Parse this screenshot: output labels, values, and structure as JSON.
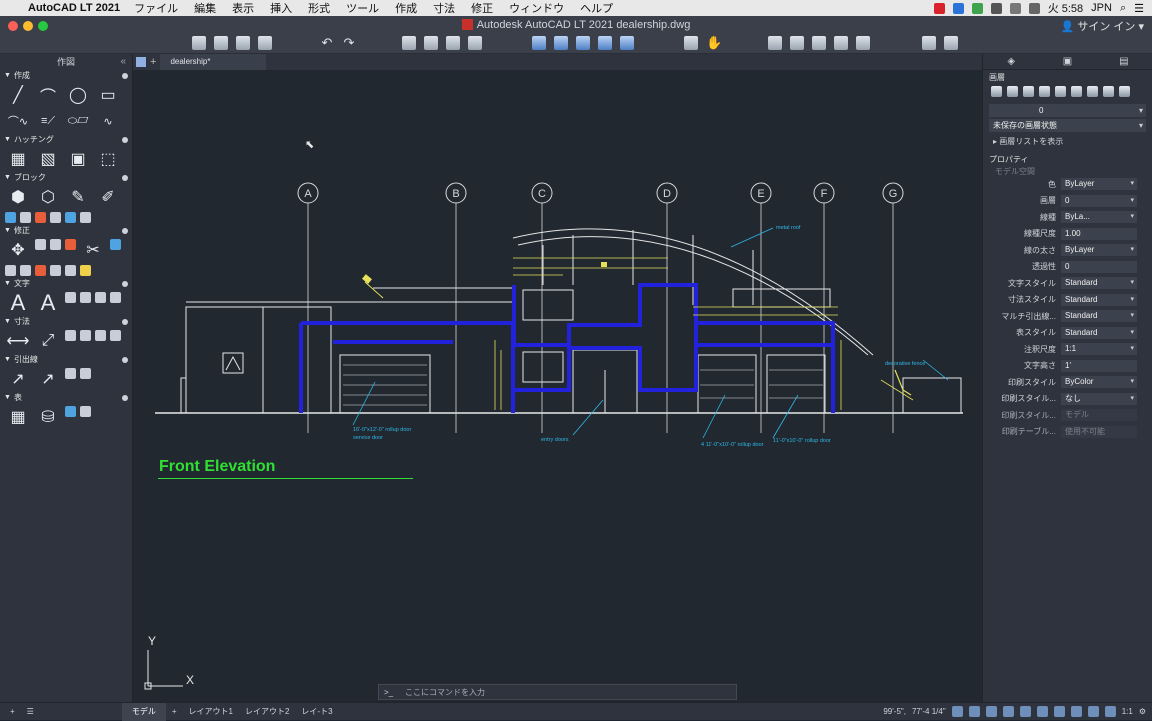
{
  "menubar": {
    "app_name": "AutoCAD LT 2021",
    "items": [
      "ファイル",
      "編集",
      "表示",
      "挿入",
      "形式",
      "ツール",
      "作成",
      "寸法",
      "修正",
      "ウィンドウ",
      "ヘルプ"
    ],
    "clock": "火 5:58",
    "input_method": "JPN"
  },
  "window": {
    "title": "Autodesk AutoCAD LT 2021   dealership.dwg",
    "signin": "サイン イン"
  },
  "left_panel": {
    "title": "作図",
    "sections": [
      "作成",
      "ハッチング",
      "ブロック",
      "修正",
      "文字",
      "寸法",
      "引出線",
      "表"
    ]
  },
  "doc_tab": "dealership*",
  "drawing": {
    "grid_labels": [
      "A",
      "B",
      "C",
      "D",
      "E",
      "F",
      "G"
    ],
    "title": "Front Elevation",
    "annotations": {
      "metal_roof": "metal roof",
      "decorative_fence": "decorative fence",
      "rollup_1": "16'-0\"x12'-0\" rollup door",
      "rollup_1b": "service door",
      "entry": "entry doors",
      "rollup_2": "4 11'-0\"x10'-0\" rollup door",
      "rollup_3": "11'-0\"x10'-0\" rollup door"
    },
    "ucs_x": "X",
    "ucs_y": "Y"
  },
  "command_line": {
    "prompt": ">_",
    "placeholder": "ここにコマンドを入力"
  },
  "right_panel": {
    "layers_title": "画層",
    "layer_current": "0",
    "layer_state": "未保存の画層状態",
    "layer_list": "画層リストを表示",
    "props_title": "プロパティ",
    "props_sub": "モデル空間",
    "properties": [
      {
        "k": "色",
        "v": "ByLayer",
        "dd": true
      },
      {
        "k": "画層",
        "v": "0",
        "dd": true
      },
      {
        "k": "線種",
        "v": "ByLa...",
        "dd": true
      },
      {
        "k": "線種尺度",
        "v": "1.00",
        "dd": false
      },
      {
        "k": "線の太さ",
        "v": "ByLayer",
        "dd": true
      },
      {
        "k": "透過性",
        "v": "0",
        "dd": false
      },
      {
        "k": "文字スタイル",
        "v": "Standard",
        "dd": true
      },
      {
        "k": "寸法スタイル",
        "v": "Standard",
        "dd": true
      },
      {
        "k": "マルチ引出線...",
        "v": "Standard",
        "dd": true
      },
      {
        "k": "表スタイル",
        "v": "Standard",
        "dd": true
      },
      {
        "k": "注釈尺度",
        "v": "1:1",
        "dd": true
      },
      {
        "k": "文字高さ",
        "v": "1'",
        "dd": false
      },
      {
        "k": "印刷スタイル",
        "v": "ByColor",
        "dd": true
      },
      {
        "k": "印刷スタイル...",
        "v": "なし",
        "dd": true
      },
      {
        "k": "印刷スタイル...",
        "v": "モデル",
        "dd": false,
        "disabled": true
      },
      {
        "k": "印刷テーブル...",
        "v": "使用不可能",
        "dd": false,
        "disabled": true
      }
    ]
  },
  "statusbar": {
    "model_tab": "モデル",
    "layouts": [
      "レイアウト1",
      "レイアウト2",
      "レイ-ト3"
    ],
    "coords": "99'-5\",",
    "coords2": "77'-4 1/4\"",
    "scale": "1:1"
  }
}
